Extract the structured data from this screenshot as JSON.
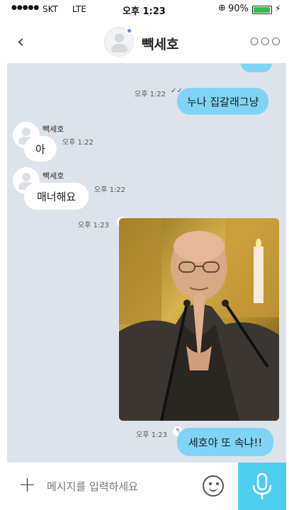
{
  "status_bar": {
    "signal": "●●●●●",
    "carrier": "SKT",
    "network": "LTE",
    "time": "오후 1:23",
    "lock_icon": "rotation-lock-icon",
    "battery_percent": "90%",
    "battery_level": 0.9,
    "charging_icon": "bolt-icon"
  },
  "header": {
    "back_icon": "chevron-left-icon",
    "contact_name": "빽세호",
    "more_icon": "more-dots-icon"
  },
  "messages": [
    {
      "from": "me",
      "text": "누나 집갈래그냥",
      "time": "오후 1:22",
      "status_icon": "read-check-icon"
    },
    {
      "from": "them",
      "sender": "빽세호",
      "text": "아",
      "time": "오후 1:22"
    },
    {
      "from": "them",
      "sender": "빽세호",
      "text": "매너해요",
      "time": "오후 1:22"
    },
    {
      "from": "me",
      "type": "image",
      "time": "오후 1:23",
      "status_icon": "reply-arrow-icon",
      "image_desc_icon": "photo-praying-monk"
    },
    {
      "from": "me",
      "text": "세호야 또 속냐!!",
      "time": "오후 1:23",
      "status_icon": "reply-arrow-icon"
    }
  ],
  "input_bar": {
    "plus_icon": "plus-icon",
    "placeholder": "메시지를 입력하세요",
    "emoji_icon": "smiley-icon",
    "mic_icon": "microphone-icon"
  },
  "colors": {
    "chat_bg": "#dde3ea",
    "my_bubble": "#7fd4f6",
    "their_bubble": "#ffffff",
    "mic_button": "#4ecdf2"
  }
}
